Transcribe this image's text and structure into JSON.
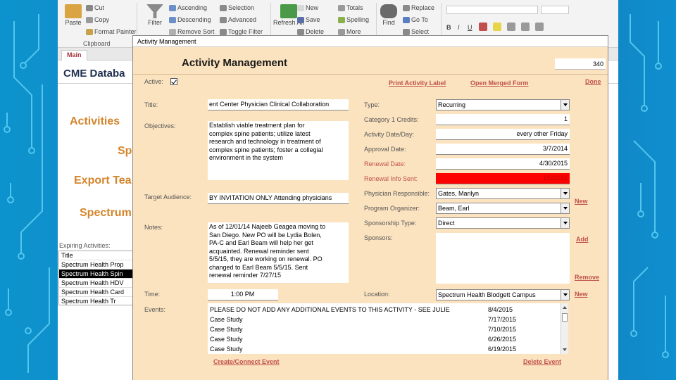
{
  "ribbon": {
    "paste": "Paste",
    "cut": "Cut",
    "copy": "Copy",
    "format_painter": "Format Painter",
    "clipboard_group": "Clipboard",
    "filter": "Filter",
    "ascending": "Ascending",
    "descending": "Descending",
    "remove_sort": "Remove Sort",
    "selection": "Selection",
    "advanced": "Advanced",
    "toggle_filter": "Toggle Filter",
    "refresh_all": "Refresh All",
    "new": "New",
    "save": "Save",
    "delete": "Delete",
    "totals": "Totals",
    "spelling": "Spelling",
    "more": "More",
    "find": "Find",
    "replace": "Replace",
    "goto": "Go To",
    "select": "Select",
    "bold": "B",
    "italic": "I",
    "underline": "U"
  },
  "main": {
    "tab_label": "Main",
    "title": "CME Databa",
    "links": [
      "Activities",
      "Sp",
      "Export Tea",
      "Spectrum"
    ],
    "expiring_label": "Expiring Activities:",
    "expiring_header": "Title",
    "expiring_items": [
      "Spectrum Health Prop",
      "Spectrum Health Spin",
      "Spectrum Health HDV",
      "Spectrum Health Card",
      "Spectrum Health Tr"
    ]
  },
  "popup": {
    "window_title": "Activity Management",
    "heading": "Activity Management",
    "id_value": "340",
    "active_label": "Active:",
    "print_label": "Print Activity Label",
    "merged_form": "Open Merged Form",
    "done": "Done",
    "title_label": "Title:",
    "title_value": "ent Center Physician Clinical Collaboration",
    "objectives_label": "Objectives:",
    "objectives_value": "Establish viable treatment plan for\ncomplex spine patients; utilize latest\nresearch and technology in treatment of\ncomplex spine patients; foster a collegial\nenvironment in the system",
    "target_label": "Target Audience:",
    "target_value": "BY INVITATION ONLY Attending physicians",
    "notes_label": "Notes:",
    "notes_value": "As of 12/01/14 Najeeb Geagea moving to\nSan Diego.  New PO will be Lydia Bolen,\nPA-C and Earl Beam will help her get\nacquainted.  Renewal reminder sent\n5/5/15, they are working on renewal.  PO\nchanged to Earl Beam 5/5/15.  Sent\nrenewal reminder 7/27/15",
    "time_label": "Time:",
    "time_value": "1:00 PM",
    "events_label": "Events:",
    "type_label": "Type:",
    "type_value": "Recurring",
    "credits_label": "Category 1 Credits:",
    "credits_value": "1",
    "day_label": "Activity Date/Day:",
    "day_value": "every other Friday",
    "approval_label": "Approval Date:",
    "approval_value": "3/7/2014",
    "renewal_label": "Renewal Date:",
    "renewal_value": "4/30/2015",
    "renewal_sent_label": "Renewal Info Sent:",
    "renewal_sent_value": "1/5/2015",
    "physician_label": "Physician Responsible:",
    "physician_value": "Gates, Marilyn",
    "organizer_label": "Program Organizer:",
    "organizer_value": "Beam, Earl",
    "sponsorship_label": "Sponsorship Type:",
    "sponsorship_value": "Direct",
    "sponsors_label": "Sponsors:",
    "location_label": "Location:",
    "location_value": "Spectrum Health Blodgett Campus",
    "new_link": "New",
    "add_link": "Add",
    "remove_link": "Remove",
    "events": [
      {
        "name": "PLEASE DO NOT ADD ANY ADDITIONAL EVENTS TO THIS ACTIVITY - SEE JULIE",
        "date": "8/4/2015"
      },
      {
        "name": "Case Study",
        "date": "7/17/2015"
      },
      {
        "name": "Case Study",
        "date": "7/10/2015"
      },
      {
        "name": "Case Study",
        "date": "6/26/2015"
      },
      {
        "name": "Case Study",
        "date": "6/19/2015"
      }
    ],
    "create_event": "Create/Connect Event",
    "delete_event": "Delete Event"
  }
}
